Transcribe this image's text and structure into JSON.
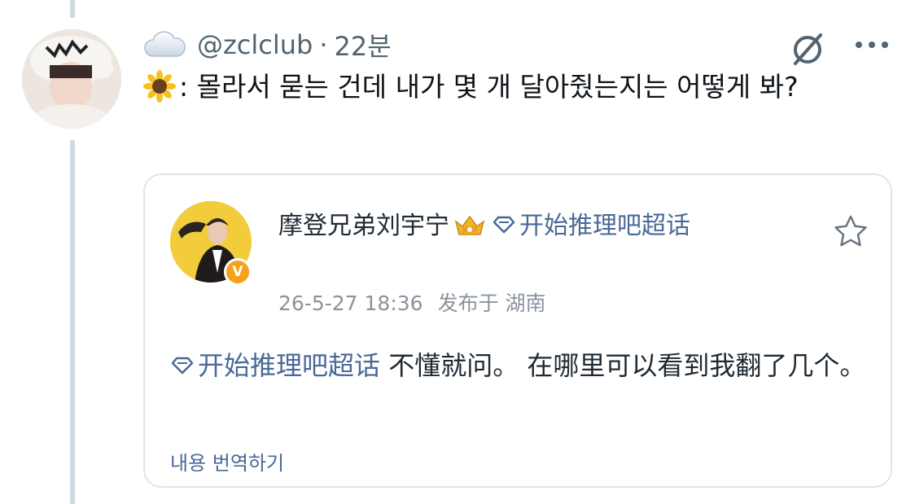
{
  "tweet": {
    "author_handle": "@zclclub",
    "separator": "·",
    "time_ago": "22분",
    "emoji_icon": "sunflower-icon",
    "text": ": 몰라서 묻는 건데 내가 몇 개 달아줬는지는 어떻게 봐?",
    "icons": {
      "account_icon": "cloud-icon",
      "mute": "no-bell-icon",
      "more": "more-icon"
    }
  },
  "quote": {
    "author_name": "摩登兄弟刘宇宁",
    "badge_icon": "crown-icon",
    "topic_link": "开始推理吧超话",
    "timestamp": "26-5-27 18:36",
    "location": "发布于 湖南",
    "body_topic": "开始推理吧超话",
    "body_text": " 不懂就问。 在哪里可以看到我翻了几个。",
    "translate_label": "내용 번역하기",
    "star_icon": "star-icon",
    "colors": {
      "link": "#4a6996",
      "verified": "#f3a21a"
    }
  },
  "colors": {
    "thread_line": "#cfd9de",
    "meta_text": "#536471",
    "border": "#dfe5e9"
  }
}
